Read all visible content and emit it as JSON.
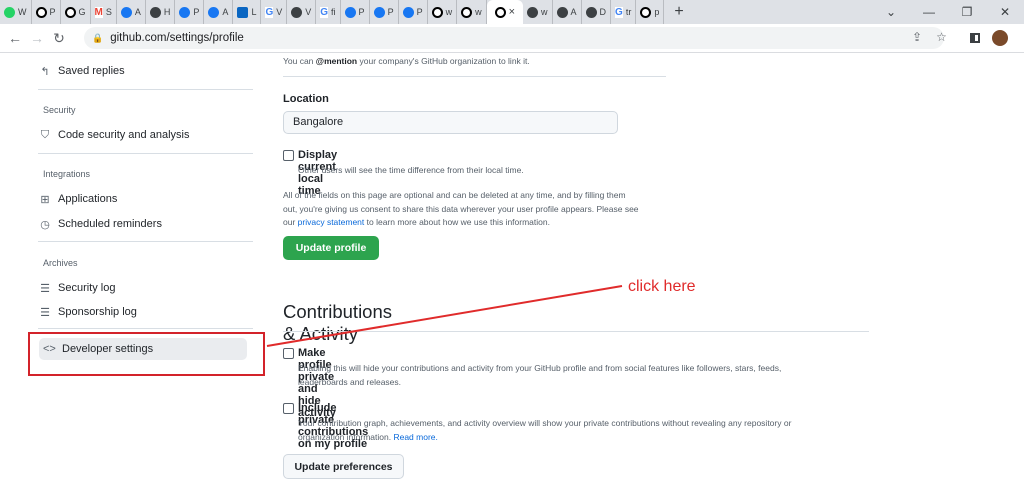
{
  "browser": {
    "tabs": [
      {
        "icon": "whatsapp-icon",
        "label": "W"
      },
      {
        "icon": "github-icon",
        "label": "P"
      },
      {
        "icon": "github-icon",
        "label": "G"
      },
      {
        "icon": "gmail-icon",
        "label": "S"
      },
      {
        "icon": "facebook-icon",
        "label": "A"
      },
      {
        "icon": "site-icon",
        "label": "H"
      },
      {
        "icon": "facebook-icon",
        "label": "P"
      },
      {
        "icon": "facebook-icon",
        "label": "A"
      },
      {
        "icon": "linkedin-icon",
        "label": "L"
      },
      {
        "icon": "google-icon",
        "label": "V"
      },
      {
        "icon": "site-icon",
        "label": "V"
      },
      {
        "icon": "google-icon",
        "label": "fi"
      },
      {
        "icon": "facebook-icon",
        "label": "P"
      },
      {
        "icon": "facebook-icon",
        "label": "P"
      },
      {
        "icon": "facebook-icon",
        "label": "P"
      },
      {
        "icon": "github-icon",
        "label": "w"
      },
      {
        "icon": "github-icon",
        "label": "w"
      }
    ],
    "active_tab_close": "×",
    "tabs_after": [
      {
        "icon": "site-icon",
        "label": "w"
      },
      {
        "icon": "site-icon",
        "label": "A"
      },
      {
        "icon": "site-icon",
        "label": "D"
      },
      {
        "icon": "google-icon",
        "label": "tr"
      },
      {
        "icon": "github-icon",
        "label": "p"
      }
    ],
    "url": "github.com/settings/profile"
  },
  "sidebar": {
    "saved_replies": "Saved replies",
    "security_heading": "Security",
    "code_security": "Code security and analysis",
    "integrations_heading": "Integrations",
    "applications": "Applications",
    "scheduled_reminders": "Scheduled reminders",
    "archives_heading": "Archives",
    "security_log": "Security log",
    "sponsorship_log": "Sponsorship log",
    "developer_settings": "Developer settings"
  },
  "main": {
    "company_note_pre": "You can ",
    "company_note_mention": "@mention",
    "company_note_post": " your company's GitHub organization to link it.",
    "location_label": "Location",
    "location_value": "Bangalore",
    "local_time_label": "Display current local time",
    "local_time_note": "Other users will see the time difference from their local time.",
    "optional_line1": "All of the fields on this page are optional and can be deleted at any time, and by filling them",
    "optional_line2": "out, you're giving us consent to share this data wherever your user profile appears. Please see",
    "optional_line3_pre": "our ",
    "optional_link": "privacy statement",
    "optional_line3_post": " to learn more about how we use this information.",
    "update_profile": "Update profile",
    "contrib_title": "Contributions & Activity",
    "private_label": "Make profile private and hide activity",
    "private_note1": "Enabling this will hide your contributions and activity from your GitHub profile and from social features like followers, stars, feeds,",
    "private_note2": "leaderboards and releases.",
    "include_label": "Include private contributions on my profile",
    "include_note1": "Your contribution graph, achievements, and activity overview will show your private contributions without revealing any repository or",
    "include_note2_pre": "organization information. ",
    "include_link": "Read more.",
    "update_preferences": "Update preferences"
  },
  "annotation": {
    "text": "click here",
    "color": "#e02b2b"
  }
}
